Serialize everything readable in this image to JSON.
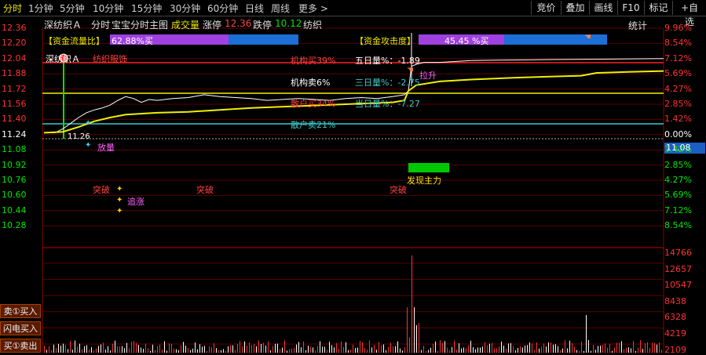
{
  "tabs": [
    "分时",
    "1分钟",
    "5分钟",
    "10分钟",
    "15分钟",
    "30分钟",
    "60分钟",
    "日线",
    "周线",
    "更多 >"
  ],
  "toolbar": {
    "auction": "竞价",
    "overlay": "叠加",
    "draw": "画线",
    "f10": "F10",
    "mark": "标记",
    "add_favorite": "+自选"
  },
  "header": {
    "stock": "深纺织Ａ",
    "mode": "分时",
    "indicator": "宝宝分时主图",
    "volume_label": "成交量",
    "limit_up_label": "涨停",
    "limit_up": "12.36",
    "limit_down_label": "跌停",
    "limit_down": "10.12",
    "sector": "纺织",
    "stats": "统计"
  },
  "price_axis": [
    "12.36",
    "12.20",
    "12.04",
    "11.88",
    "11.72",
    "11.56",
    "11.40",
    "11.24",
    "11.08",
    "10.92",
    "10.76",
    "10.60",
    "10.44",
    "10.28"
  ],
  "pct_axis": [
    "9.96%",
    "8.54%",
    "7.12%",
    "5.69%",
    "4.27%",
    "2.85%",
    "1.42%",
    "0.00%",
    "1.42%",
    "2.85%",
    "4.27%",
    "5.69%",
    "7.12%",
    "8.54%"
  ],
  "current_price": "11.08",
  "volume_axis": [
    "14766",
    "12657",
    "10547",
    "8438",
    "6328",
    "4219",
    "2109"
  ],
  "capital_flow": {
    "label": "【资金流量比】",
    "value": "62.88%买",
    "fill": 0.6288
  },
  "capital_attack": {
    "label": "【资金攻击度】",
    "value": "45.45 %买",
    "fill": 0.4545
  },
  "sector_label": "纺织服饰",
  "inst_buy": "机构买39%",
  "inst_sell": "机构卖6%",
  "retail_buy": "散户买34%",
  "retail_sell": "散户卖21%",
  "five_day": "五日量%：-1.89",
  "three_day": "三日量%：-2.75",
  "today_vol": "当日量%：-7.27",
  "rise_label": "拉升",
  "open_price": "11.26",
  "chip_label": "放量",
  "breakouts": [
    "突破",
    "突破",
    "突破"
  ],
  "chase_label": "追涨",
  "main_force": "发现主力",
  "bottom_breakout": "突破",
  "side_buttons": [
    "卖①买入",
    "闪电买入",
    "买①卖出"
  ],
  "colors": {
    "up": "#ff3232",
    "down": "#00e600",
    "avg": "#f0f000",
    "price": "#ffffff",
    "grid": "#8b0000"
  }
}
